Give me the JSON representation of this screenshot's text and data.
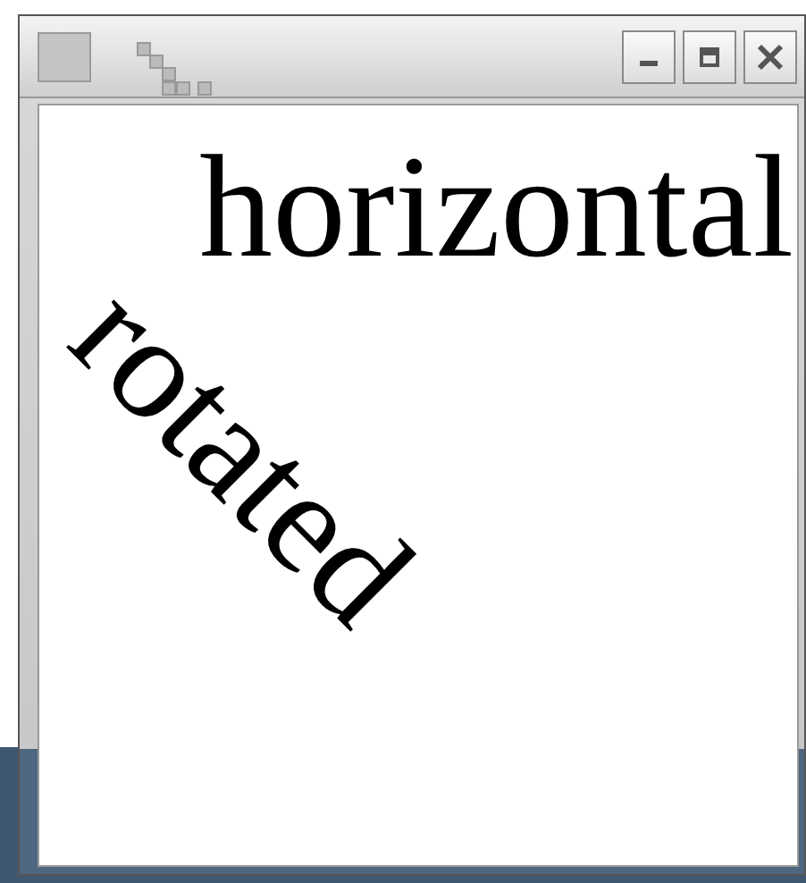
{
  "texts": [
    {
      "kind": "horizontal",
      "text": "horizontal"
    },
    {
      "kind": "rotated",
      "text": "rotated"
    }
  ]
}
